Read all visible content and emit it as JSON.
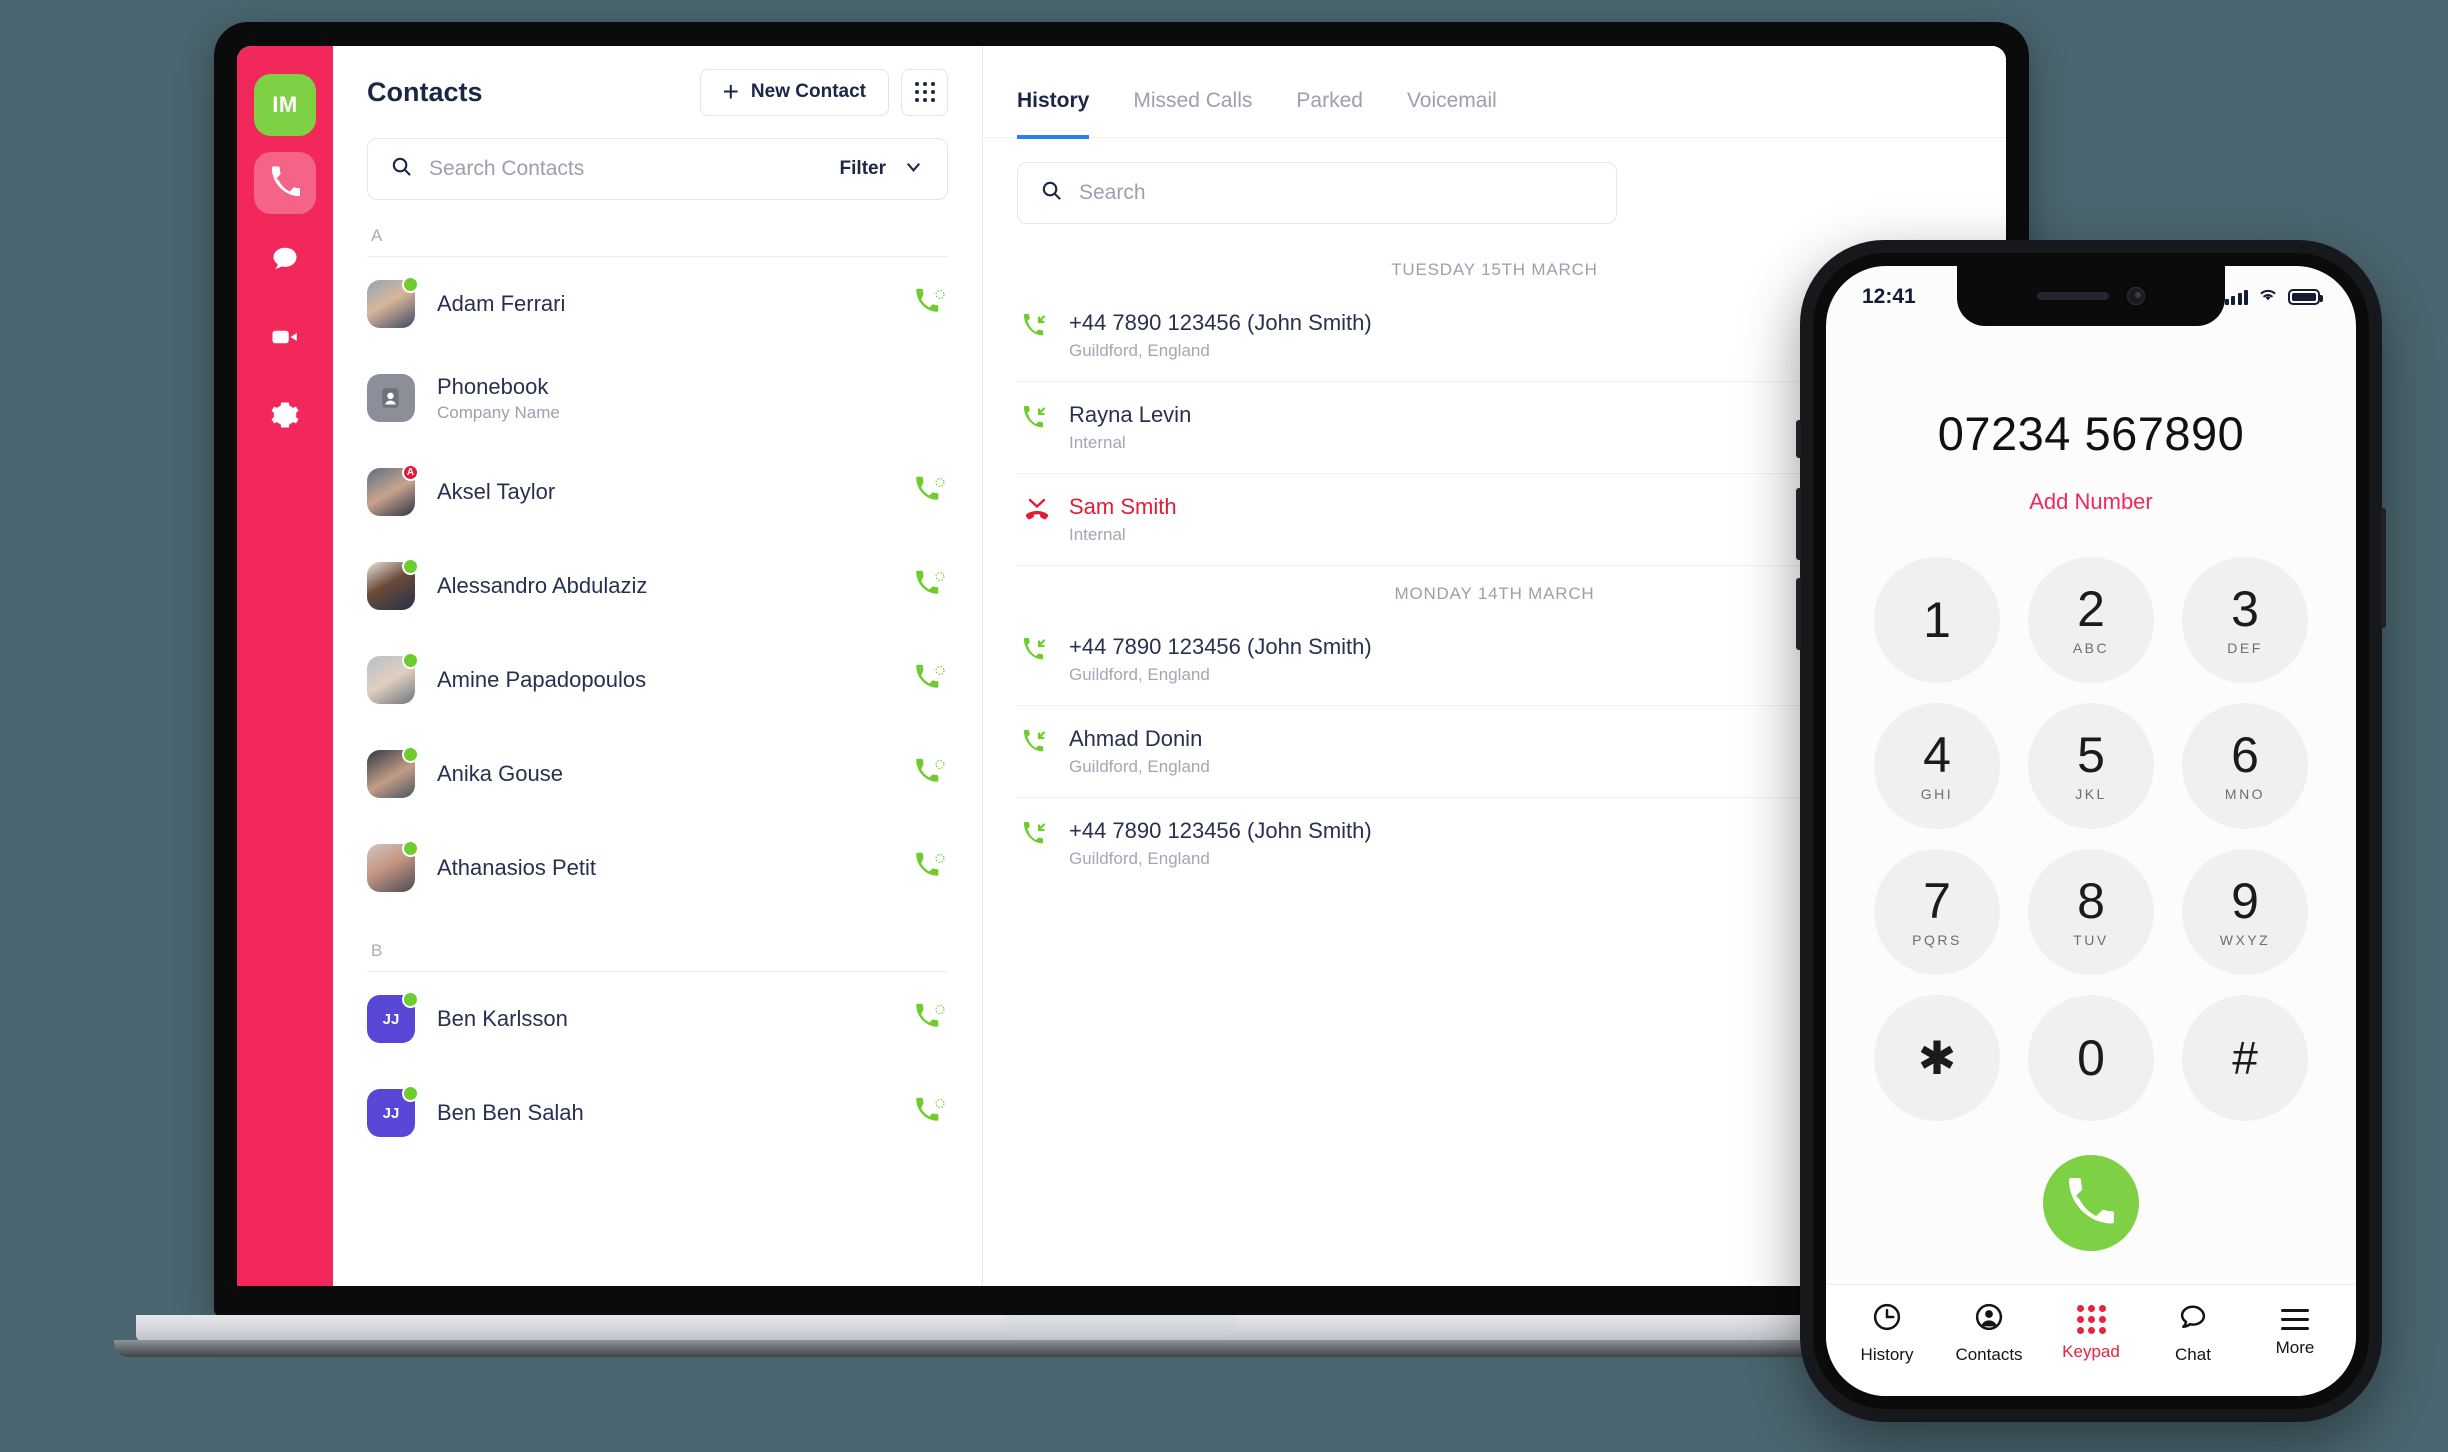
{
  "app": {
    "rail": {
      "user_initials": "IM",
      "items": [
        {
          "name": "phone",
          "label": "Phone",
          "active": true
        },
        {
          "name": "chat",
          "label": "Chat",
          "active": false
        },
        {
          "name": "video",
          "label": "Video",
          "active": false
        },
        {
          "name": "settings",
          "label": "Settings",
          "active": false
        }
      ]
    },
    "contacts": {
      "title": "Contacts",
      "new_contact_label": "New Contact",
      "plus": "+",
      "grid_icon": "grid-dots-icon",
      "search_placeholder": "Search Contacts",
      "search_value": "",
      "filter_label": "Filter",
      "groups": [
        {
          "letter": "A",
          "rows": [
            {
              "name": "Adam Ferrari",
              "sub": "",
              "avatar": "photo",
              "photo_class": "ph-a",
              "status": "online",
              "status_text": "",
              "call": true
            },
            {
              "name": "Phonebook",
              "sub": "Company Name",
              "avatar": "book",
              "photo_class": "ph-book",
              "status": "none",
              "status_text": "",
              "call": false
            },
            {
              "name": "Aksel Taylor",
              "sub": "",
              "avatar": "photo",
              "photo_class": "ph-c",
              "status": "away",
              "status_text": "A",
              "call": true
            },
            {
              "name": "Alessandro Abdulaziz",
              "sub": "",
              "avatar": "photo",
              "photo_class": "ph-d",
              "status": "online",
              "status_text": "",
              "call": true
            },
            {
              "name": "Amine Papadopoulos",
              "sub": "",
              "avatar": "photo",
              "photo_class": "ph-e",
              "status": "online",
              "status_text": "",
              "call": true
            },
            {
              "name": "Anika Gouse",
              "sub": "",
              "avatar": "photo",
              "photo_class": "ph-f",
              "status": "online",
              "status_text": "",
              "call": true
            },
            {
              "name": "Athanasios Petit",
              "sub": "",
              "avatar": "photo",
              "photo_class": "ph-g",
              "status": "online",
              "status_text": "",
              "call": true
            }
          ]
        },
        {
          "letter": "B",
          "rows": [
            {
              "name": "Ben Karlsson",
              "sub": "",
              "avatar": "initials",
              "initials": "JJ",
              "photo_class": "ph-init",
              "status": "online",
              "status_text": "",
              "call": true
            },
            {
              "name": "Ben Ben Salah",
              "sub": "",
              "avatar": "initials",
              "initials": "JJ",
              "photo_class": "ph-init",
              "status": "online",
              "status_text": "",
              "call": true
            }
          ]
        }
      ]
    },
    "history": {
      "tabs": [
        {
          "label": "History",
          "active": true
        },
        {
          "label": "Missed Calls",
          "active": false
        },
        {
          "label": "Parked",
          "active": false
        },
        {
          "label": "Voicemail",
          "active": false
        }
      ],
      "search_placeholder": "Search",
      "search_value": "",
      "groups": [
        {
          "date": "TUESDAY 15TH MARCH",
          "calls": [
            {
              "title": "+44 7890 123456 (John Smith)",
              "sub": "Guildford, England",
              "type": "incoming"
            },
            {
              "title": "Rayna Levin",
              "sub": "Internal",
              "type": "incoming"
            },
            {
              "title": "Sam Smith",
              "sub": "Internal",
              "type": "missed"
            }
          ]
        },
        {
          "date": "MONDAY 14TH MARCH",
          "calls": [
            {
              "title": "+44 7890 123456 (John Smith)",
              "sub": "Guildford, England",
              "type": "incoming"
            },
            {
              "title": "Ahmad Donin",
              "sub": "Guildford, England",
              "type": "incoming"
            },
            {
              "title": "+44 7890 123456 (John Smith)",
              "sub": "Guildford, England",
              "type": "incoming"
            }
          ]
        }
      ]
    }
  },
  "phone": {
    "statusbar": {
      "time": "12:41",
      "signal_icon": "signal-bars-icon",
      "wifi_icon": "wifi-icon",
      "battery_icon": "battery-icon"
    },
    "dialer": {
      "number": "07234 567890",
      "add_number_label": "Add Number",
      "keys": [
        {
          "num": "1",
          "letters": ""
        },
        {
          "num": "2",
          "letters": "ABC"
        },
        {
          "num": "3",
          "letters": "DEF"
        },
        {
          "num": "4",
          "letters": "GHI"
        },
        {
          "num": "5",
          "letters": "JKL"
        },
        {
          "num": "6",
          "letters": "MNO"
        },
        {
          "num": "7",
          "letters": "PQRS"
        },
        {
          "num": "8",
          "letters": "TUV"
        },
        {
          "num": "9",
          "letters": "WXYZ"
        },
        {
          "num": "✱",
          "letters": ""
        },
        {
          "num": "0",
          "letters": ""
        },
        {
          "num": "#",
          "letters": ""
        }
      ],
      "call_button_icon": "phone-icon"
    },
    "tabbar": [
      {
        "label": "History",
        "icon": "clock-icon",
        "active": false
      },
      {
        "label": "Contacts",
        "icon": "person-circle-icon",
        "active": false
      },
      {
        "label": "Keypad",
        "icon": "keypad-dots-icon",
        "active": true
      },
      {
        "label": "Chat",
        "icon": "chat-bubble-icon",
        "active": false
      },
      {
        "label": "More",
        "icon": "hamburger-icon",
        "active": false
      }
    ]
  },
  "colors": {
    "brand_pink": "#f2285a",
    "accent_green": "#7ed045",
    "tab_active_blue": "#2b7ef0",
    "missed_red": "#e01c36",
    "initials_purple": "#5a46d6",
    "page_background": "#4b6670"
  }
}
